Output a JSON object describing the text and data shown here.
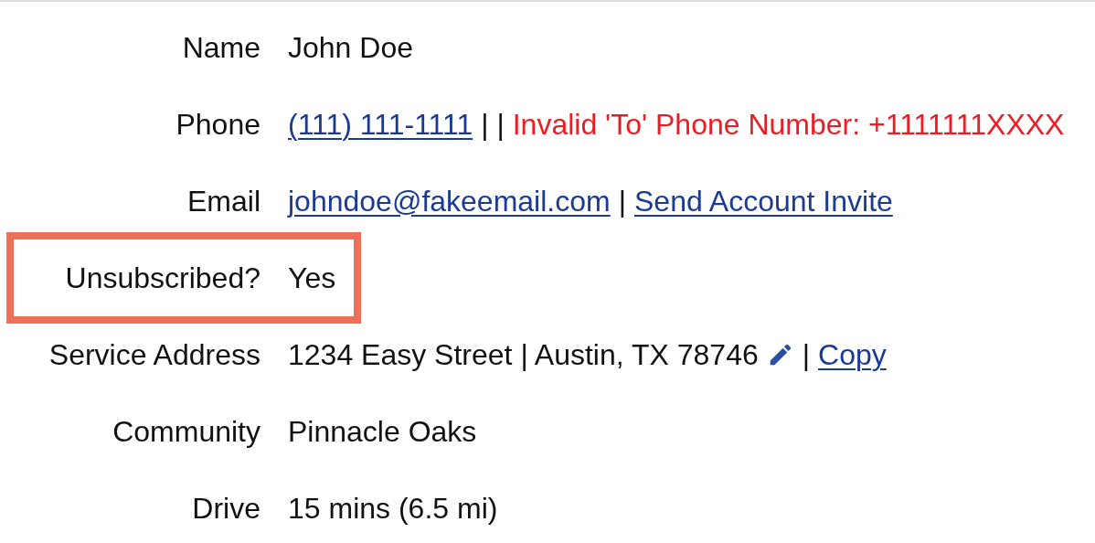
{
  "rows": [
    {
      "label": "Name",
      "highlighted": false,
      "parts": [
        {
          "kind": "text",
          "text": "John Doe"
        }
      ]
    },
    {
      "label": "Phone",
      "highlighted": false,
      "parts": [
        {
          "kind": "link",
          "text": "(111) 111-1111"
        },
        {
          "kind": "text",
          "text": "| |"
        },
        {
          "kind": "error",
          "text": "Invalid 'To' Phone Number: +1111111XXXX"
        }
      ]
    },
    {
      "label": "Email",
      "highlighted": false,
      "parts": [
        {
          "kind": "link",
          "text": "johndoe@fakeemail.com"
        },
        {
          "kind": "text",
          "text": "|"
        },
        {
          "kind": "link",
          "text": "Send Account Invite"
        }
      ]
    },
    {
      "label": "Unsubscribed?",
      "highlighted": true,
      "parts": [
        {
          "kind": "text",
          "text": "Yes"
        }
      ]
    },
    {
      "label": "Service Address",
      "highlighted": false,
      "parts": [
        {
          "kind": "text",
          "text": "1234 Easy Street | Austin, TX 78746"
        },
        {
          "kind": "edit"
        },
        {
          "kind": "text",
          "text": "|"
        },
        {
          "kind": "link",
          "text": "Copy"
        }
      ]
    },
    {
      "label": "Community",
      "highlighted": false,
      "parts": [
        {
          "kind": "text",
          "text": "Pinnacle Oaks"
        }
      ]
    },
    {
      "label": "Drive",
      "highlighted": false,
      "parts": [
        {
          "kind": "text",
          "text": "15 mins (6.5 mi)"
        }
      ]
    }
  ]
}
